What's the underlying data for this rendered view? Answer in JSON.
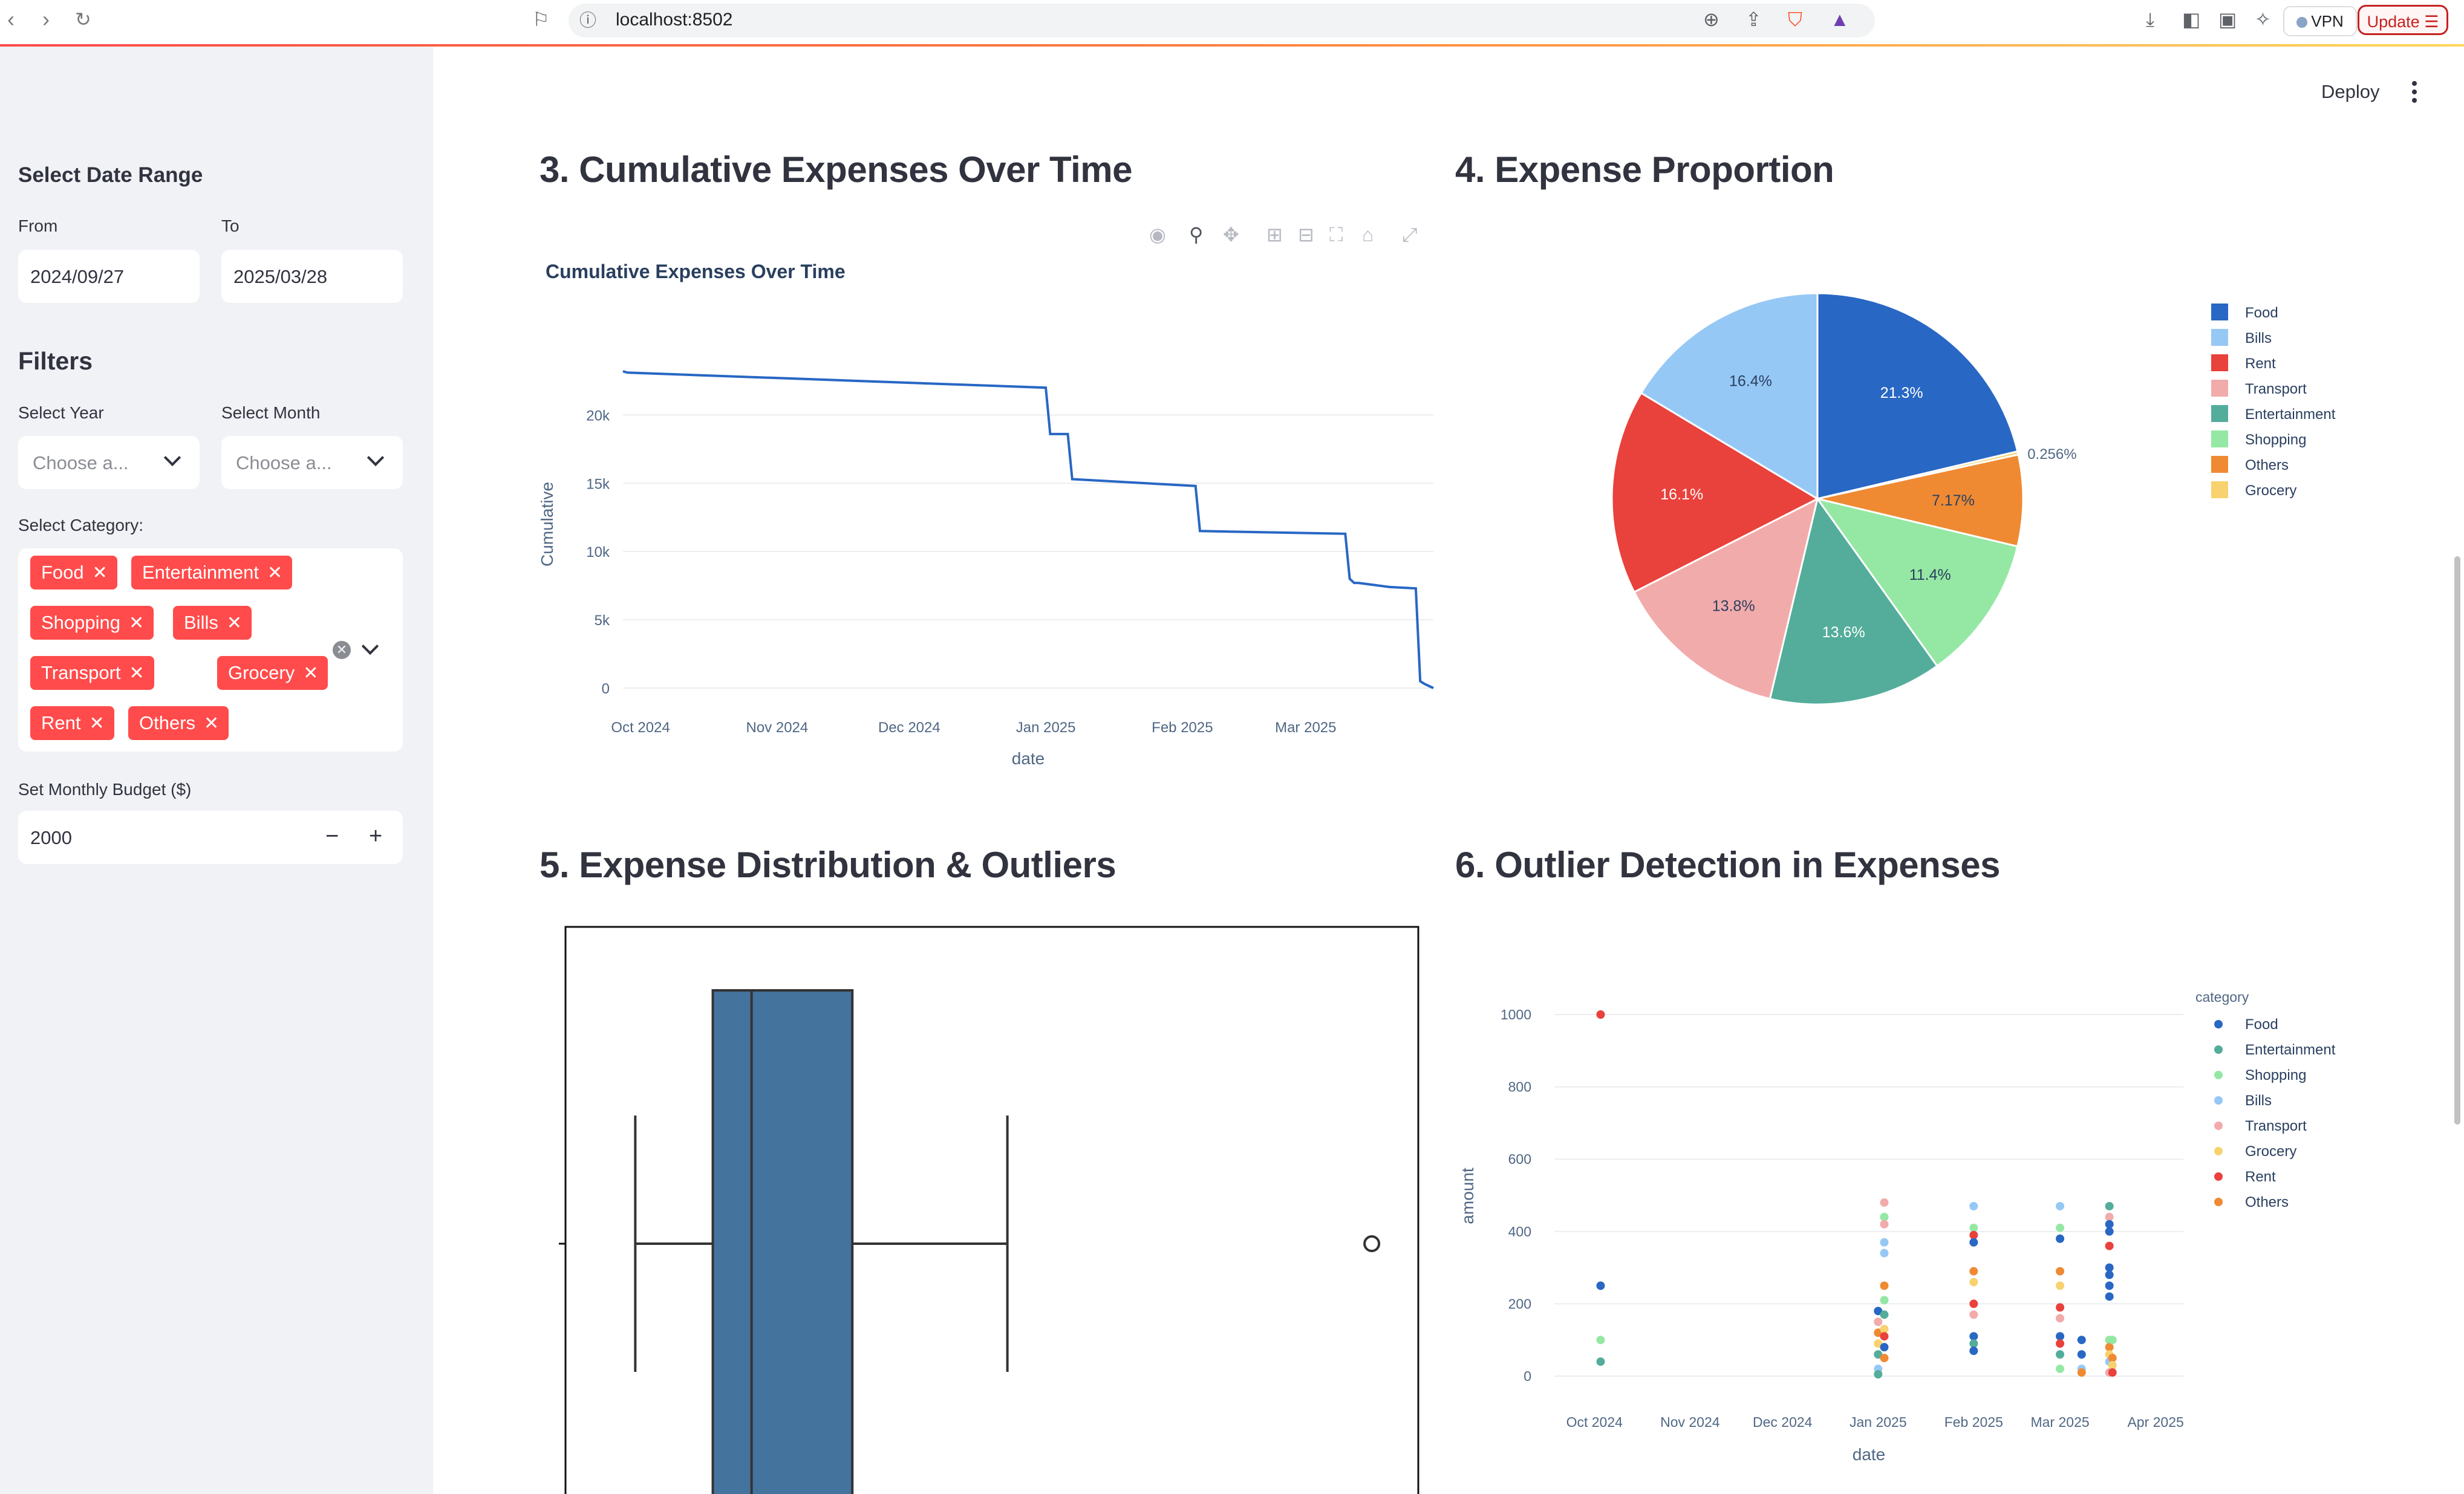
{
  "browser": {
    "url": "localhost:8502",
    "vpn_label": "VPN",
    "update_label": "Update"
  },
  "sidebar": {
    "date_range_heading": "Select Date Range",
    "from_label": "From",
    "from_value": "2024/09/27",
    "to_label": "To",
    "to_value": "2025/03/28",
    "filters_heading": "Filters",
    "year_label": "Select Year",
    "year_placeholder": "Choose a...",
    "month_label": "Select Month",
    "month_placeholder": "Choose a...",
    "category_label": "Select Category:",
    "categories": [
      "Food",
      "Entertainment",
      "Shopping",
      "Bills",
      "Transport",
      "Grocery",
      "Rent",
      "Others"
    ],
    "budget_label": "Set Monthly Budget ($)",
    "budget_value": "2000",
    "minus": "−",
    "plus": "+"
  },
  "header": {
    "deploy_label": "Deploy"
  },
  "sections": {
    "s3": "3. Cumulative Expenses Over Time",
    "s4": "4. Expense Proportion",
    "s5": "5. Expense Distribution & Outliers",
    "s6": "6. Outlier Detection in Expenses"
  },
  "colors": {
    "Food": "#2867c4",
    "Bills": "#96c8f6",
    "Rent": "#e9413c",
    "Transport": "#f2abab",
    "Entertainment": "#53ad9a",
    "Shopping": "#95e8a4",
    "Others": "#ef8a33",
    "Grocery": "#f7d26f",
    "accent": "#ff4b4b",
    "box_fill": "#44739d"
  },
  "chart_data": [
    {
      "type": "line",
      "title": "Cumulative Expenses Over Time",
      "xlabel": "date",
      "ylabel": "Cumulative",
      "x_ticks": [
        "Oct 2024",
        "Nov 2024",
        "Dec 2024",
        "Jan 2025",
        "Feb 2025",
        "Mar 2025"
      ],
      "y_ticks": [
        "0",
        "5k",
        "10k",
        "15k",
        "20k"
      ],
      "ylim": [
        0,
        24000
      ],
      "grid": true,
      "x": [
        "2024-09-27",
        "2024-09-28",
        "2025-01-01",
        "2025-01-02",
        "2025-01-06",
        "2025-01-07",
        "2025-02-04",
        "2025-02-05",
        "2025-03-10",
        "2025-03-11",
        "2025-03-12",
        "2025-03-13",
        "2025-03-20",
        "2025-03-26",
        "2025-03-27",
        "2025-03-28",
        "2025-03-30"
      ],
      "y": [
        23200,
        23100,
        22000,
        18600,
        18600,
        15300,
        14800,
        11500,
        11300,
        8000,
        7700,
        7700,
        7400,
        7300,
        500,
        300,
        0
      ]
    },
    {
      "type": "pie",
      "legend_position": "right",
      "labels": [
        "Food",
        "Bills",
        "Rent",
        "Transport",
        "Entertainment",
        "Shopping",
        "Others",
        "Grocery"
      ],
      "slice_order": [
        "Food",
        "Grocery",
        "Others",
        "Shopping",
        "Entertainment",
        "Transport",
        "Rent",
        "Bills"
      ],
      "values": {
        "Food": 21.3,
        "Grocery": 0.256,
        "Others": 7.17,
        "Shopping": 11.4,
        "Entertainment": 13.6,
        "Transport": 13.8,
        "Rent": 16.1,
        "Bills": 16.4
      },
      "value_labels": {
        "Food": "21.3%",
        "Grocery": "0.256%",
        "Others": "7.17%",
        "Shopping": "11.4%",
        "Entertainment": "13.6%",
        "Transport": "13.8%",
        "Rent": "16.1%",
        "Bills": "16.4%"
      }
    },
    {
      "type": "box",
      "orientation": "horizontal",
      "whisker_low": 45,
      "q1": 95,
      "median": 120,
      "q3": 185,
      "whisker_high": 285,
      "outliers": [
        520
      ],
      "xlim": [
        0,
        550
      ]
    },
    {
      "type": "scatter",
      "xlabel": "date",
      "ylabel": "amount",
      "legend_title": "category",
      "legend_position": "right",
      "legend": [
        "Food",
        "Entertainment",
        "Shopping",
        "Bills",
        "Transport",
        "Grocery",
        "Rent",
        "Others"
      ],
      "x_ticks": [
        "Oct 2024",
        "Nov 2024",
        "Dec 2024",
        "Jan 2025",
        "Feb 2025",
        "Mar 2025",
        "Apr 2025"
      ],
      "y_ticks": [
        "0",
        "200",
        "400",
        "600",
        "800",
        "1000"
      ],
      "ylim": [
        0,
        1000
      ],
      "grid": true,
      "points": [
        {
          "x": "2024-10-03",
          "y": 1000,
          "c": "Rent"
        },
        {
          "x": "2024-10-03",
          "y": 250,
          "c": "Food"
        },
        {
          "x": "2024-10-03",
          "y": 100,
          "c": "Shopping"
        },
        {
          "x": "2024-10-03",
          "y": 40,
          "c": "Entertainment"
        },
        {
          "x": "2025-01-01",
          "y": 180,
          "c": "Food"
        },
        {
          "x": "2025-01-01",
          "y": 150,
          "c": "Transport"
        },
        {
          "x": "2025-01-01",
          "y": 120,
          "c": "Others"
        },
        {
          "x": "2025-01-01",
          "y": 90,
          "c": "Grocery"
        },
        {
          "x": "2025-01-01",
          "y": 60,
          "c": "Entertainment"
        },
        {
          "x": "2025-01-01",
          "y": 20,
          "c": "Bills"
        },
        {
          "x": "2025-01-01",
          "y": 5,
          "c": "Entertainment"
        },
        {
          "x": "2025-01-03",
          "y": 480,
          "c": "Transport"
        },
        {
          "x": "2025-01-03",
          "y": 440,
          "c": "Shopping"
        },
        {
          "x": "2025-01-03",
          "y": 420,
          "c": "Transport"
        },
        {
          "x": "2025-01-03",
          "y": 370,
          "c": "Bills"
        },
        {
          "x": "2025-01-03",
          "y": 340,
          "c": "Bills"
        },
        {
          "x": "2025-01-03",
          "y": 250,
          "c": "Others"
        },
        {
          "x": "2025-01-03",
          "y": 210,
          "c": "Shopping"
        },
        {
          "x": "2025-01-03",
          "y": 170,
          "c": "Entertainment"
        },
        {
          "x": "2025-01-03",
          "y": 130,
          "c": "Grocery"
        },
        {
          "x": "2025-01-03",
          "y": 110,
          "c": "Rent"
        },
        {
          "x": "2025-01-03",
          "y": 80,
          "c": "Food"
        },
        {
          "x": "2025-01-03",
          "y": 50,
          "c": "Others"
        },
        {
          "x": "2025-02-01",
          "y": 470,
          "c": "Bills"
        },
        {
          "x": "2025-02-01",
          "y": 410,
          "c": "Shopping"
        },
        {
          "x": "2025-02-01",
          "y": 390,
          "c": "Rent"
        },
        {
          "x": "2025-02-01",
          "y": 370,
          "c": "Food"
        },
        {
          "x": "2025-02-01",
          "y": 290,
          "c": "Others"
        },
        {
          "x": "2025-02-01",
          "y": 260,
          "c": "Grocery"
        },
        {
          "x": "2025-02-01",
          "y": 200,
          "c": "Rent"
        },
        {
          "x": "2025-02-01",
          "y": 170,
          "c": "Transport"
        },
        {
          "x": "2025-02-01",
          "y": 110,
          "c": "Food"
        },
        {
          "x": "2025-02-01",
          "y": 90,
          "c": "Entertainment"
        },
        {
          "x": "2025-02-01",
          "y": 70,
          "c": "Food"
        },
        {
          "x": "2025-03-01",
          "y": 470,
          "c": "Bills"
        },
        {
          "x": "2025-03-01",
          "y": 410,
          "c": "Shopping"
        },
        {
          "x": "2025-03-01",
          "y": 380,
          "c": "Food"
        },
        {
          "x": "2025-03-01",
          "y": 290,
          "c": "Others"
        },
        {
          "x": "2025-03-01",
          "y": 250,
          "c": "Grocery"
        },
        {
          "x": "2025-03-01",
          "y": 190,
          "c": "Rent"
        },
        {
          "x": "2025-03-01",
          "y": 160,
          "c": "Transport"
        },
        {
          "x": "2025-03-01",
          "y": 110,
          "c": "Food"
        },
        {
          "x": "2025-03-01",
          "y": 90,
          "c": "Rent"
        },
        {
          "x": "2025-03-01",
          "y": 60,
          "c": "Entertainment"
        },
        {
          "x": "2025-03-01",
          "y": 20,
          "c": "Shopping"
        },
        {
          "x": "2025-03-08",
          "y": 100,
          "c": "Food"
        },
        {
          "x": "2025-03-08",
          "y": 60,
          "c": "Food"
        },
        {
          "x": "2025-03-08",
          "y": 20,
          "c": "Bills"
        },
        {
          "x": "2025-03-08",
          "y": 10,
          "c": "Others"
        },
        {
          "x": "2025-03-17",
          "y": 470,
          "c": "Entertainment"
        },
        {
          "x": "2025-03-17",
          "y": 440,
          "c": "Transport"
        },
        {
          "x": "2025-03-17",
          "y": 420,
          "c": "Food"
        },
        {
          "x": "2025-03-17",
          "y": 400,
          "c": "Food"
        },
        {
          "x": "2025-03-17",
          "y": 360,
          "c": "Rent"
        },
        {
          "x": "2025-03-17",
          "y": 300,
          "c": "Food"
        },
        {
          "x": "2025-03-17",
          "y": 280,
          "c": "Food"
        },
        {
          "x": "2025-03-17",
          "y": 250,
          "c": "Food"
        },
        {
          "x": "2025-03-17",
          "y": 220,
          "c": "Food"
        },
        {
          "x": "2025-03-17",
          "y": 100,
          "c": "Shopping"
        },
        {
          "x": "2025-03-17",
          "y": 80,
          "c": "Others"
        },
        {
          "x": "2025-03-17",
          "y": 60,
          "c": "Grocery"
        },
        {
          "x": "2025-03-17",
          "y": 40,
          "c": "Bills"
        },
        {
          "x": "2025-03-17",
          "y": 10,
          "c": "Transport"
        },
        {
          "x": "2025-03-18",
          "y": 100,
          "c": "Shopping"
        },
        {
          "x": "2025-03-18",
          "y": 50,
          "c": "Others"
        },
        {
          "x": "2025-03-18",
          "y": 30,
          "c": "Grocery"
        },
        {
          "x": "2025-03-18",
          "y": 10,
          "c": "Rent"
        }
      ]
    }
  ]
}
